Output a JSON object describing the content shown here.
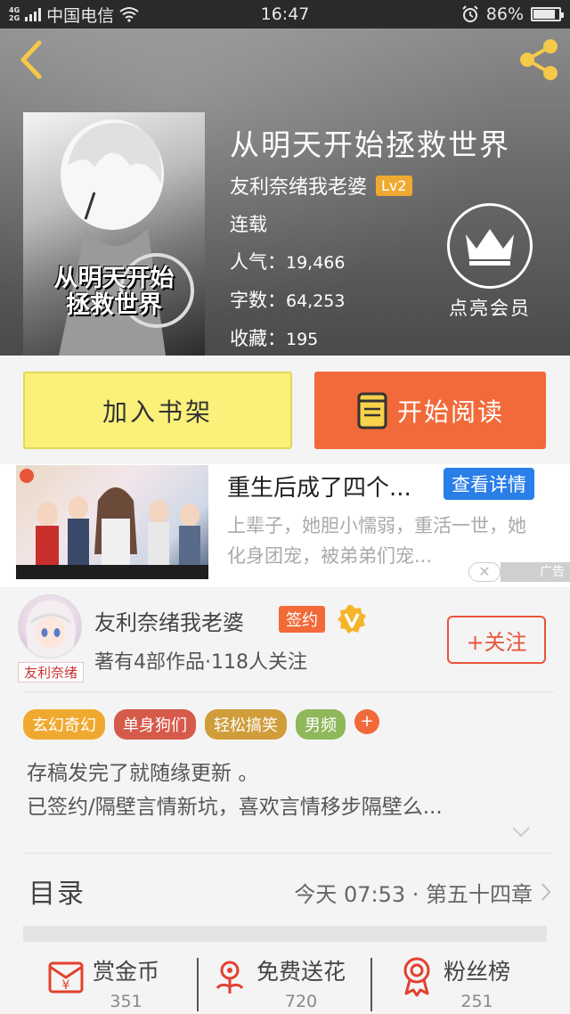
{
  "status_bar": {
    "network_top": "4G",
    "network_bottom": "2G",
    "carrier": "中国电信",
    "time": "16:47",
    "battery": "86%",
    "battery_level": 0.86
  },
  "book": {
    "title": "从明天开始拯救世界",
    "cover_title": "从明天开始\n拯救世界",
    "author": "友利奈绪我老婆",
    "author_level": "Lv2",
    "status": "连载",
    "popularity_label": "人气：",
    "popularity": "19,466",
    "words_label": "字数：",
    "words": "64,253",
    "favorites_label": "收藏：",
    "favorites": "195"
  },
  "vip": {
    "label": "点亮会员",
    "icon": "crown-icon"
  },
  "actions": {
    "add_shelf": "加入书架",
    "start_reading": "开始阅读"
  },
  "ad": {
    "title": "重生后成了四个...",
    "detail_button": "查看详情",
    "description": "上辈子，她胆小懦弱，重活一世，她化身团宠，被弟弟们宠...",
    "tag": "广告",
    "close": "✕",
    "colors": {
      "detail_button": "#2a7ee8"
    }
  },
  "author": {
    "name": "友利奈绪我老婆",
    "sign_badge": "签约",
    "avatar_caption": "友利奈绪",
    "stats": "著有4部作品·118人关注",
    "follow_button": "+关注",
    "tags": [
      {
        "label": "玄幻奇幻",
        "color": "#f0a930"
      },
      {
        "label": "单身狗们",
        "color": "#d65a4a"
      },
      {
        "label": "轻松搞笑",
        "color": "#d09d3a"
      },
      {
        "label": "男频",
        "color": "#8fb85a"
      }
    ],
    "tag_more": "+",
    "description_line1": "存稿发完了就随缘更新 。",
    "description_line2": "已签约/隔壁言情新坑，喜欢言情移步隔壁么..."
  },
  "toc": {
    "label": "目录",
    "latest": "今天 07:53 · 第五十四章"
  },
  "rewards": [
    {
      "label": "赏金币",
      "count": "351",
      "icon": "coin-envelope-icon"
    },
    {
      "label": "免费送花",
      "count": "720",
      "icon": "flower-icon"
    },
    {
      "label": "粉丝榜",
      "count": "251",
      "icon": "medal-icon"
    }
  ],
  "colors": {
    "accent": "#f26a3a",
    "shelf": "#faf07a",
    "header": "#6a6a6a"
  }
}
